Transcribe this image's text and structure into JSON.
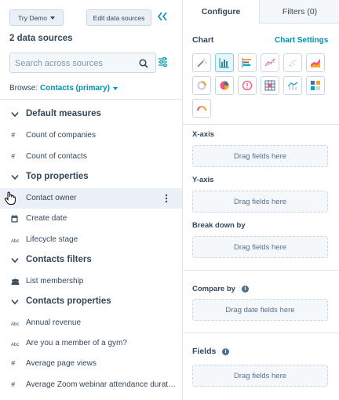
{
  "toolbar": {
    "try_demo": "Try Demo",
    "edit_data_sources": "Edit data sources"
  },
  "sources": {
    "title": "2 data sources",
    "search_placeholder": "Search across sources",
    "browse_label": "Browse:",
    "browse_value": "Contacts (primary)"
  },
  "list": {
    "sections": [
      {
        "label": "Default measures",
        "items": [
          {
            "label": "Count of companies",
            "type": "#"
          },
          {
            "label": "Count of contacts",
            "type": "#"
          }
        ]
      },
      {
        "label": "Top properties",
        "items": [
          {
            "label": "Contact owner",
            "type": "owner"
          },
          {
            "label": "Create date",
            "type": "date"
          },
          {
            "label": "Lifecycle stage",
            "type": "Abc"
          }
        ]
      },
      {
        "label": "Contacts filters",
        "items": [
          {
            "label": "List membership",
            "type": "list"
          }
        ]
      },
      {
        "label": "Contacts properties",
        "items": [
          {
            "label": "Annual revenue",
            "type": "Abc"
          },
          {
            "label": "Are you a member of a gym?",
            "type": "Abc"
          },
          {
            "label": "Average page views",
            "type": "#"
          },
          {
            "label": "Average Zoom webinar attendance durat…",
            "type": "#"
          }
        ]
      }
    ]
  },
  "tabs": {
    "configure": "Configure",
    "filters": "Filters (0)"
  },
  "chart": {
    "title": "Chart",
    "settings_link": "Chart Settings",
    "types": [
      "magic-wand",
      "vertical-bar",
      "horizontal-bar",
      "line",
      "scatter",
      "area",
      "donut",
      "pie",
      "kpi",
      "pivot-table",
      "combo",
      "table",
      "gauge"
    ],
    "selected_type": "vertical-bar"
  },
  "axes": {
    "x_label": "X-axis",
    "x_drop": "Drag fields here",
    "y_label": "Y-axis",
    "y_drop": "Drag fields here",
    "break_label": "Break down by",
    "break_drop": "Drag fields here"
  },
  "compare": {
    "label": "Compare by",
    "drop": "Drag date fields here"
  },
  "fields": {
    "title": "Fields",
    "drop": "Drag fields here"
  },
  "colors": {
    "accent": "#0091ae",
    "text": "#33475b",
    "border": "#cbd6e2",
    "selected_bg": "#e5f5f8"
  }
}
